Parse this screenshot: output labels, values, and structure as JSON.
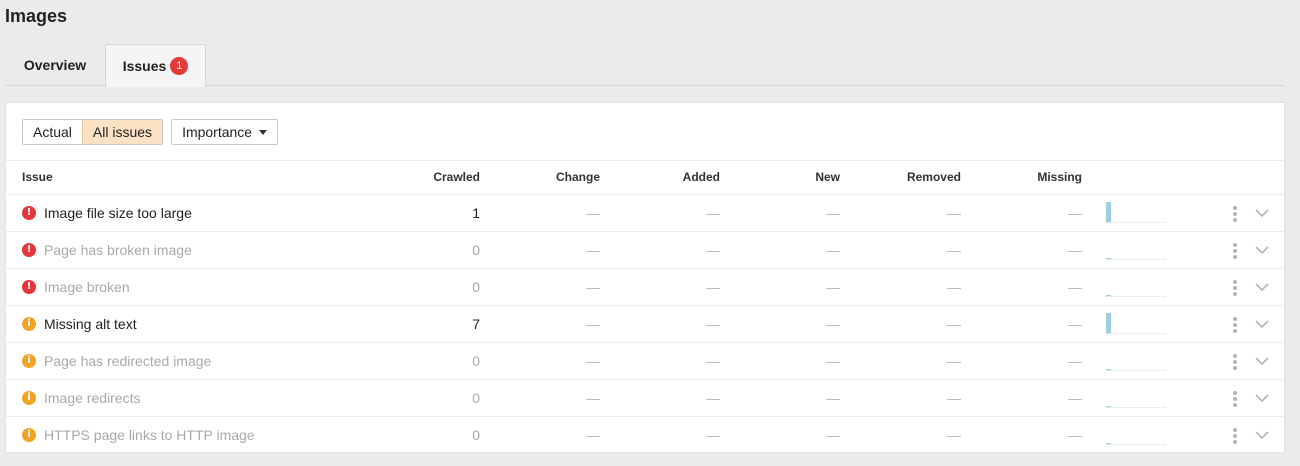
{
  "page": {
    "title": "Images"
  },
  "tabs": [
    {
      "label": "Overview"
    },
    {
      "label": "Issues",
      "badge": "1"
    }
  ],
  "filters": {
    "actual_label": "Actual",
    "all_issues_label": "All issues",
    "importance_label": "Importance"
  },
  "table": {
    "headers": {
      "issue": "Issue",
      "crawled": "Crawled",
      "change": "Change",
      "added": "Added",
      "new": "New",
      "removed": "Removed",
      "missing": "Missing"
    },
    "rows": [
      {
        "severity": "error",
        "icon": "error-icon",
        "issue": "Image file size too large",
        "crawled": "1",
        "change": "—",
        "added": "—",
        "new": "—",
        "removed": "—",
        "missing": "—",
        "spark_fraction": 1.0
      },
      {
        "severity": "error",
        "icon": "error-icon",
        "issue": "Page has broken image",
        "crawled": "0",
        "change": "—",
        "added": "—",
        "new": "—",
        "removed": "—",
        "missing": "—",
        "spark_fraction": 0
      },
      {
        "severity": "error",
        "icon": "error-icon",
        "issue": "Image broken",
        "crawled": "0",
        "change": "—",
        "added": "—",
        "new": "—",
        "removed": "—",
        "missing": "—",
        "spark_fraction": 0
      },
      {
        "severity": "warning",
        "icon": "info-icon",
        "issue": "Missing alt text",
        "crawled": "7",
        "change": "—",
        "added": "—",
        "new": "—",
        "removed": "—",
        "missing": "—",
        "spark_fraction": 1.0
      },
      {
        "severity": "warning",
        "icon": "info-icon",
        "issue": "Page has redirected image",
        "crawled": "0",
        "change": "—",
        "added": "—",
        "new": "—",
        "removed": "—",
        "missing": "—",
        "spark_fraction": 0
      },
      {
        "severity": "warning",
        "icon": "info-icon",
        "issue": "Image redirects",
        "crawled": "0",
        "change": "—",
        "added": "—",
        "new": "—",
        "removed": "—",
        "missing": "—",
        "spark_fraction": 0
      },
      {
        "severity": "warning",
        "icon": "info-icon",
        "issue": "HTTPS page links to HTTP image",
        "crawled": "0",
        "change": "—",
        "added": "—",
        "new": "—",
        "removed": "—",
        "missing": "—",
        "spark_fraction": 0
      }
    ]
  },
  "colors": {
    "error": "#e5373b",
    "warning": "#f0a426",
    "badge": "#e63939",
    "active_filter": "#fce1c4",
    "spark": "#9fcfdf"
  }
}
